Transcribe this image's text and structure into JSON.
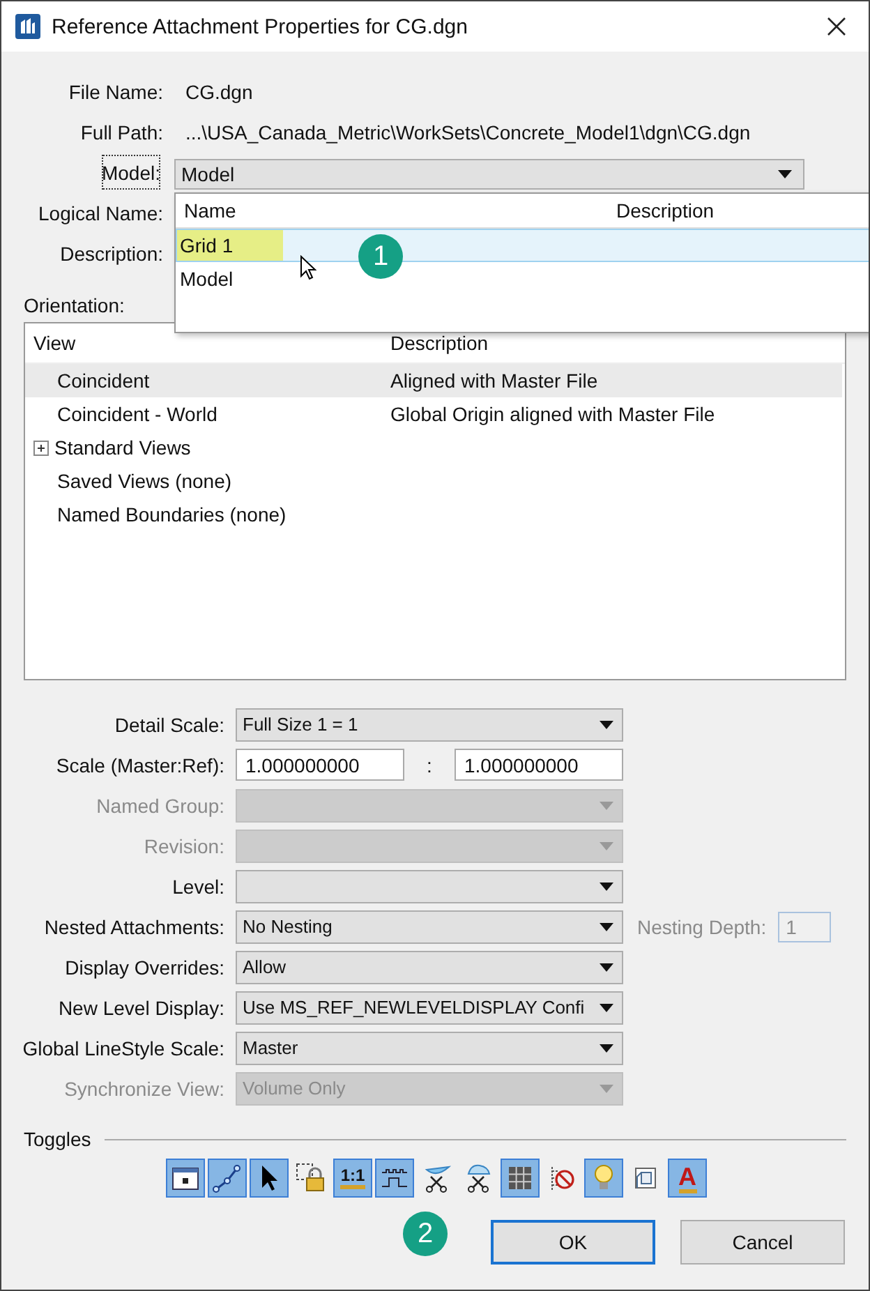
{
  "window": {
    "title": "Reference Attachment Properties for CG.dgn"
  },
  "file_info": [
    {
      "label": "File Name:",
      "value": "CG.dgn"
    },
    {
      "label": "Full Path:",
      "value": "...\\USA_Canada_Metric\\WorkSets\\Concrete_Model1\\dgn\\CG.dgn"
    }
  ],
  "model": {
    "label": "Model:",
    "value": "Model",
    "focused": true
  },
  "covered_labels": [
    {
      "label": "Logical Name:"
    },
    {
      "label": "Description:"
    }
  ],
  "model_dropdown": {
    "columns": [
      "Name",
      "Description"
    ],
    "callout": "1",
    "items": [
      {
        "name": "Grid 1",
        "selected": true,
        "highlighted": true
      },
      {
        "name": "Model",
        "selected": false,
        "highlighted": false
      }
    ]
  },
  "orientation": {
    "label": "Orientation:",
    "columns": [
      "View",
      "Description"
    ],
    "rows": [
      {
        "view": "Coincident",
        "description": "Aligned with Master File",
        "selected": true
      },
      {
        "view": "Coincident - World",
        "description": "Global Origin aligned with Master File",
        "selected": false
      },
      {
        "view": "Standard Views",
        "selected": false,
        "expandable": true,
        "expanded": false
      },
      {
        "view": "Saved Views (none)",
        "selected": false
      },
      {
        "view": "Named Boundaries (none)",
        "selected": false
      }
    ]
  },
  "settings": [
    {
      "kind": "combo",
      "label": "Detail Scale:",
      "value": "Full Size 1 = 1",
      "disabled": false
    },
    {
      "kind": "ratio",
      "label": "Scale (Master:Ref):",
      "value": "1.000000000",
      "separator": ":",
      "value2": "1.000000000",
      "disabled": false
    },
    {
      "kind": "combo",
      "label": "Named Group:",
      "disabled": true
    },
    {
      "kind": "combo",
      "label": "Revision:",
      "disabled": true
    },
    {
      "kind": "combo",
      "label": "Level:",
      "disabled": false
    },
    {
      "kind": "combo",
      "label": "Nested Attachments:",
      "value": "No Nesting",
      "disabled": false,
      "extra": {
        "label": "Nesting Depth:",
        "value": "1",
        "disabled": true
      }
    },
    {
      "kind": "combo",
      "label": "Display Overrides:",
      "value": "Allow",
      "disabled": false
    },
    {
      "kind": "combo",
      "label": "New Level Display:",
      "value": "Use MS_REF_NEWLEVELDISPLAY Confi",
      "disabled": false
    },
    {
      "kind": "combo",
      "label": "Global LineStyle Scale:",
      "value": "Master",
      "disabled": false
    },
    {
      "kind": "combo",
      "label": "Synchronize View:",
      "value": "Volume Only",
      "disabled": true
    }
  ],
  "toggles": {
    "label": "Toggles",
    "items": [
      {
        "kind": "display",
        "on": true
      },
      {
        "kind": "snap",
        "on": true
      },
      {
        "kind": "locate",
        "on": true
      },
      {
        "kind": "lock",
        "on": false
      },
      {
        "kind": "scale",
        "on": true,
        "text": "1:1"
      },
      {
        "kind": "pulse",
        "on": true
      },
      {
        "kind": "clip-back",
        "on": false
      },
      {
        "kind": "clip-front",
        "on": false
      },
      {
        "kind": "grid",
        "on": true
      },
      {
        "kind": "no-display",
        "on": false
      },
      {
        "kind": "bulb",
        "on": true
      },
      {
        "kind": "cube",
        "on": false
      },
      {
        "kind": "letter",
        "on": true,
        "text": "A"
      }
    ]
  },
  "buttons": {
    "callout": "2",
    "items": [
      {
        "label": "OK",
        "default": true
      },
      {
        "label": "Cancel",
        "default": false
      }
    ]
  }
}
